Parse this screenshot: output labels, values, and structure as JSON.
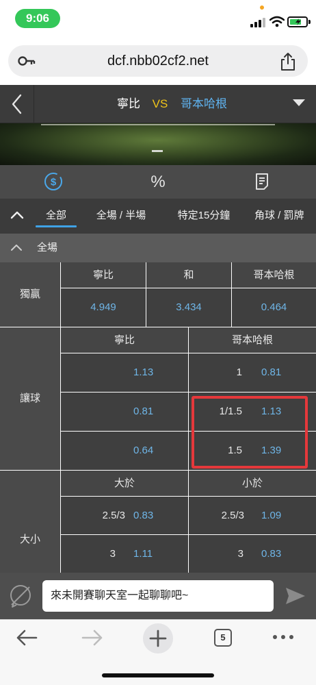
{
  "status_bar": {
    "time": "9:06"
  },
  "browser": {
    "url": "dcf.nbb02cf2.net",
    "open_tabs": "5"
  },
  "match": {
    "home_team": "寧比",
    "vs": "VS",
    "away_team": "哥本哈根"
  },
  "icon_tabs": {
    "percent": "%"
  },
  "category_tabs": [
    {
      "label": "全部"
    },
    {
      "label": "全場 / 半場"
    },
    {
      "label": "特定15分鐘"
    },
    {
      "label": "角球 / 罰牌"
    }
  ],
  "section": {
    "title": "全場"
  },
  "moneyline": {
    "label": "獨贏",
    "headers": [
      "寧比",
      "和",
      "哥本哈根"
    ],
    "odds": [
      "4.949",
      "3.434",
      "0.464"
    ]
  },
  "handicap": {
    "label": "讓球",
    "headers": [
      "寧比",
      "哥本哈根"
    ],
    "rows": [
      {
        "home_odds": "1.13",
        "away_line": "1",
        "away_odds": "0.81"
      },
      {
        "home_odds": "0.81",
        "away_line": "1/1.5",
        "away_odds": "1.13"
      },
      {
        "home_odds": "0.64",
        "away_line": "1.5",
        "away_odds": "1.39"
      }
    ]
  },
  "over_under": {
    "label": "大小",
    "headers": [
      "大於",
      "小於"
    ],
    "rows": [
      {
        "over_line": "2.5/3",
        "over_odds": "0.83",
        "under_line": "2.5/3",
        "under_odds": "1.09"
      },
      {
        "over_line": "3",
        "over_odds": "1.11",
        "under_line": "3",
        "under_odds": "0.83"
      }
    ]
  },
  "chat": {
    "placeholder": "來未開賽聊天室一起聊聊吧~"
  },
  "colors": {
    "accent_blue": "#6fb6e8",
    "vs_yellow": "#f0c419",
    "highlight_red": "#e5383b",
    "time_green": "#34c759"
  }
}
